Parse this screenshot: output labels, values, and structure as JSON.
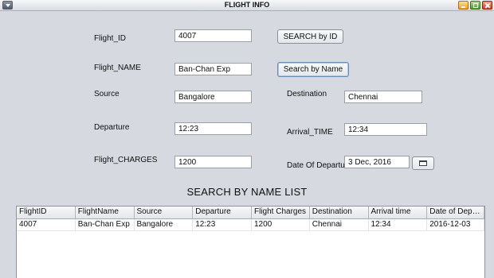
{
  "window": {
    "title": "FLIGHT INFO"
  },
  "form": {
    "flight_id": {
      "label": "Flight_ID",
      "value": "4007"
    },
    "flight_name": {
      "label": "Flight_NAME",
      "value": "Ban-Chan Exp"
    },
    "source": {
      "label": "Source",
      "value": "Bangalore"
    },
    "destination": {
      "label": "Destination",
      "value": "Chennai"
    },
    "departure": {
      "label": "Departure",
      "value": "12:23"
    },
    "arrival_time": {
      "label": "Arrival_TIME",
      "value": "12:34"
    },
    "flight_charges": {
      "label": "Flight_CHARGES",
      "value": "1200"
    },
    "date_of_departure": {
      "label": "Date Of Departure",
      "value": "3 Dec, 2016"
    }
  },
  "buttons": {
    "search_by_id": "SEARCH by ID",
    "search_by_name": "Search by Name"
  },
  "list": {
    "title": "SEARCH BY NAME LIST",
    "columns": [
      "FlightID",
      "FlightName",
      "Source",
      "Departure",
      "Flight Charges",
      "Destination",
      "Arrival time",
      "Date of Depart..."
    ],
    "rows": [
      [
        "4007",
        "Ban-Chan Exp",
        "Bangalore",
        "12:23",
        "1200",
        "Chennai",
        "12:34",
        "2016-12-03"
      ]
    ]
  },
  "icons": {
    "window_menu": "window-menu-icon",
    "minimize": "minimize-icon",
    "maximize": "maximize-icon",
    "close": "close-icon",
    "calendar": "calendar-icon"
  }
}
